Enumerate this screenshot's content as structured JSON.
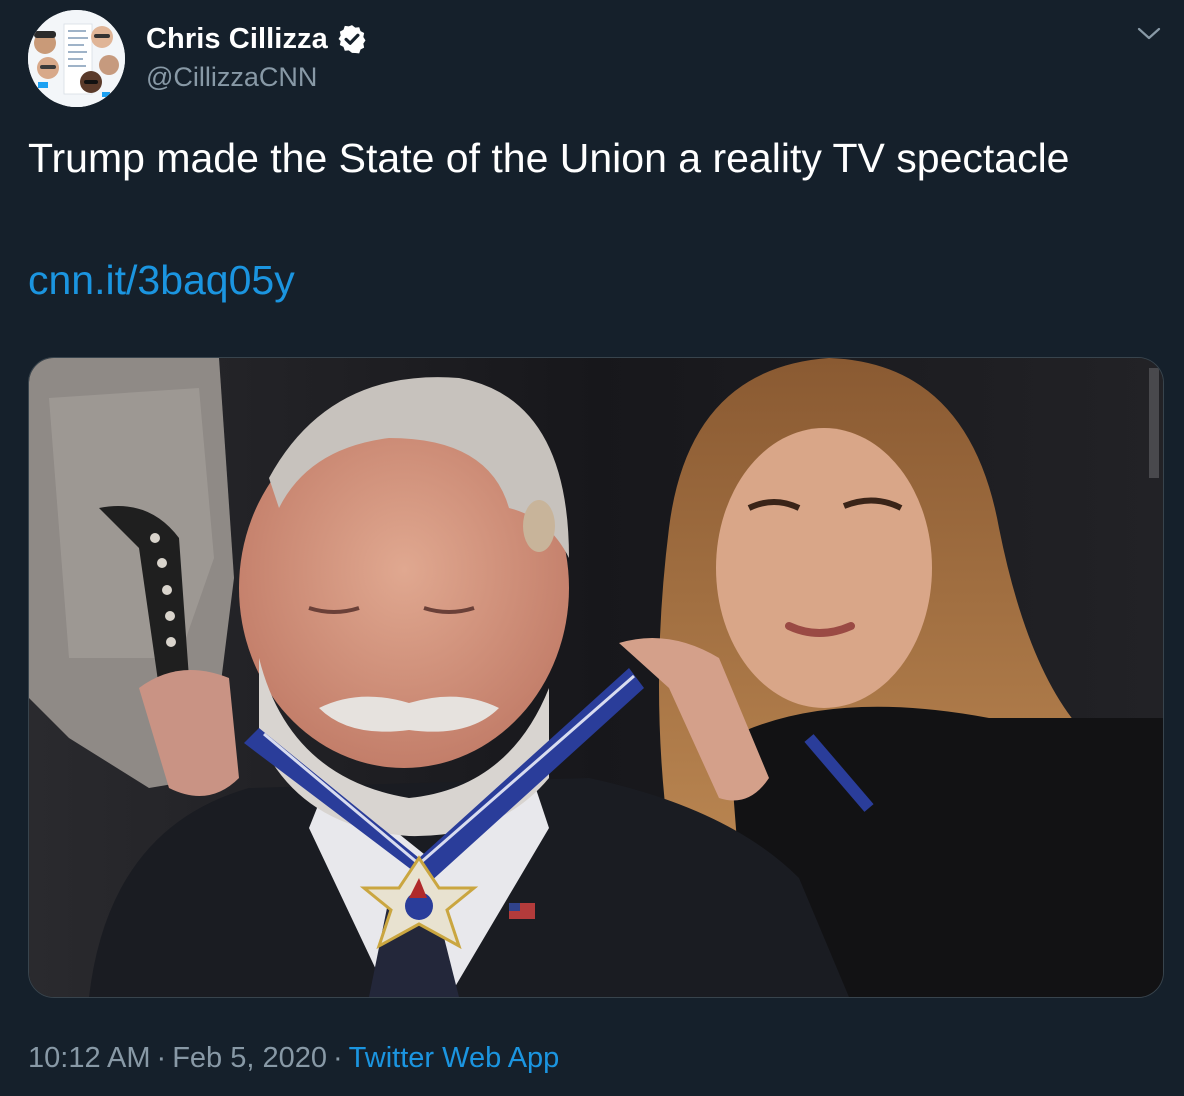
{
  "author": {
    "display_name": "Chris Cillizza",
    "handle": "@CillizzaCNN",
    "verified": true
  },
  "tweet": {
    "text": "Trump made the State of the Union a reality TV spectacle",
    "link_text": "cnn.it/3baq05y"
  },
  "meta": {
    "time": "10:12 AM",
    "separator": "·",
    "date": "Feb 5, 2020",
    "source": "Twitter Web App"
  },
  "icons": {
    "verified": "verified-badge-icon",
    "more": "chevron-down-icon"
  },
  "colors": {
    "background": "#15202b",
    "text": "#ffffff",
    "secondary_text": "#8899a6",
    "link": "#1b95e0",
    "border": "#38444d"
  }
}
